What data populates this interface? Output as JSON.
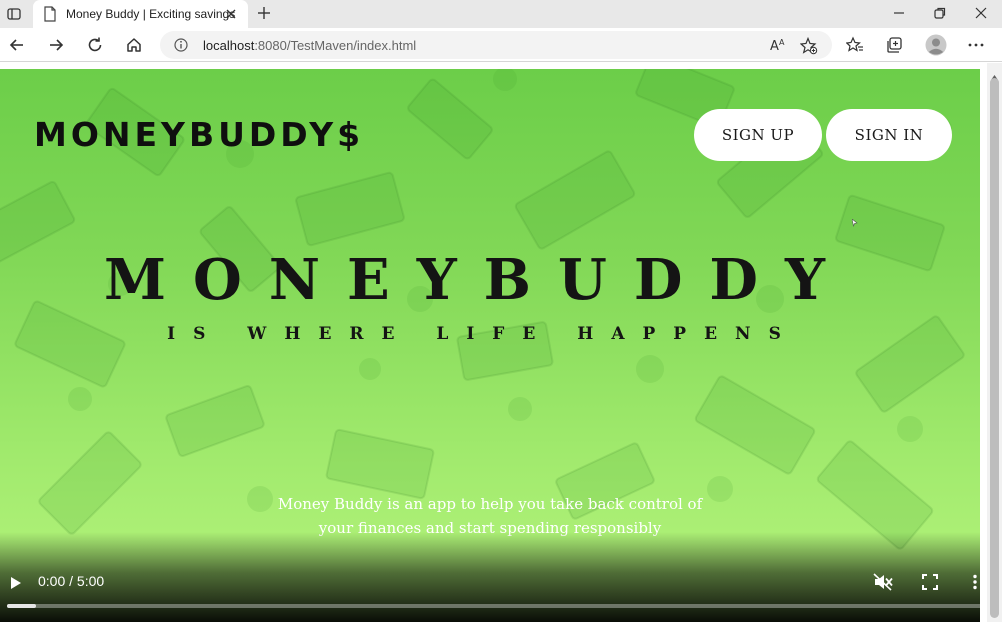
{
  "browser": {
    "tab": {
      "title": "Money Buddy | Exciting savings",
      "favicon": "page-icon",
      "close_icon": "close-icon"
    },
    "new_tab_icon": "plus-icon",
    "window_controls": [
      "minimize-icon",
      "restore-icon",
      "close-icon"
    ],
    "toolbar": {
      "nav_icons": [
        "back-arrow-icon",
        "forward-arrow-icon",
        "reload-icon",
        "home-icon"
      ],
      "address": {
        "host": "localhost",
        "path": ":8080/TestMaven/index.html",
        "info_icon": "info-icon"
      },
      "right_icons": [
        "read-aloud-icon",
        "add-favorite-icon",
        "favorites-icon",
        "collections-icon",
        "profile-avatar",
        "more-icon"
      ]
    }
  },
  "page": {
    "logo": "MONEYBUDDY$",
    "nav": {
      "sign_up": "SIGN UP",
      "sign_in": "SIGN IN"
    },
    "hero": {
      "title": "MONEYBUDDY",
      "subtitle": "IS WHERE LIFE HAPPENS",
      "description": "Money Buddy is an app to help you take back control of your finances and start spending responsibly"
    },
    "colors": {
      "hero_green_top": "#6cce49",
      "hero_green_bottom": "#b7f57e",
      "button_bg": "#ffffff",
      "text_dark": "#141414"
    },
    "video": {
      "time": "0:00 / 5:00",
      "progress": 0.03,
      "play_icon": "play-icon",
      "mute_icon": "muted-speaker-icon",
      "fullscreen_icon": "fullscreen-icon",
      "more_icon": "vertical-dots-icon"
    }
  }
}
